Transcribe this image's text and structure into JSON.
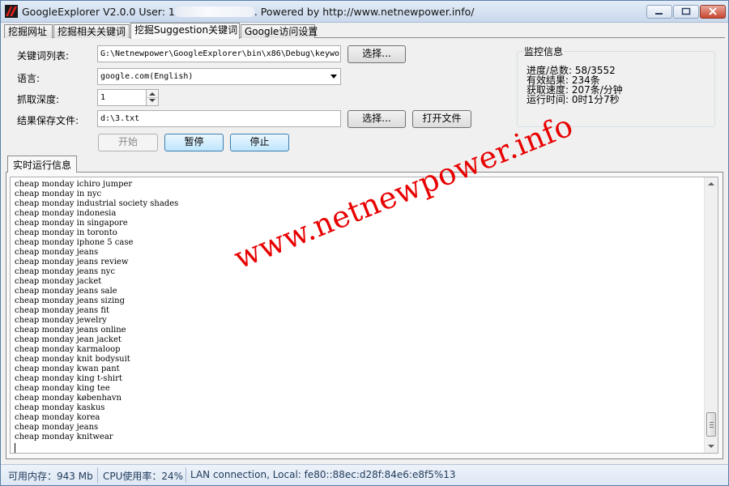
{
  "window": {
    "title_prefix": "GoogleExplorer V2.0.0 User: 1",
    "title_suffix": ". Powered by http://www.netnewpower.info/"
  },
  "tabs": [
    {
      "label": "挖掘网址"
    },
    {
      "label": "挖掘相关关键词"
    },
    {
      "label": "挖掘Suggestion关键词"
    },
    {
      "label": "Google访问设置"
    }
  ],
  "form": {
    "keyword_list_label": "关键词列表:",
    "keyword_list_value": "G:\\Netnewpower\\GoogleExplorer\\bin\\x86\\Debug\\keywo",
    "language_label": "语言:",
    "language_value": "google.com(English)",
    "depth_label": "抓取深度:",
    "depth_value": "1",
    "save_file_label": "结果保存文件:",
    "save_file_value": "d:\\3.txt",
    "choose_label": "选择...",
    "choose_label_2": "选择...",
    "open_file_label": "打开文件",
    "start_label": "开始",
    "pause_label": "暂停",
    "stop_label": "停止"
  },
  "monitor": {
    "title": "监控信息",
    "progress": "进度/总数: 58/3552",
    "valid_results": "有效结果: 234条",
    "speed": "获取速度: 207条/分钟",
    "runtime": "运行时间: 0时1分7秒"
  },
  "log": {
    "tab_label": "实时运行信息",
    "lines": [
      "cheap monday ichiro jumper",
      "cheap monday in nyc",
      "cheap monday industrial society shades",
      "cheap monday indonesia",
      "cheap monday in singapore",
      "cheap monday in toronto",
      "cheap monday iphone 5 case",
      "cheap monday jeans",
      "cheap monday jeans review",
      "cheap monday jeans nyc",
      "cheap monday jacket",
      "cheap monday jeans sale",
      "cheap monday jeans sizing",
      "cheap monday jeans fit",
      "cheap monday jewelry",
      "cheap monday jeans online",
      "cheap monday jean jacket",
      "cheap monday karmaloop",
      "cheap monday knit bodysuit",
      "cheap monday kwan pant",
      "cheap monday king t-shirt",
      "cheap monday king tee",
      "cheap monday københavn",
      "cheap monday kaskus",
      "cheap monday korea",
      "cheap monday jeans",
      "cheap monday knitwear"
    ]
  },
  "watermark": "www.netnewpower.info",
  "statusbar": {
    "memory": "可用内存：943 Mb",
    "cpu": "CPU使用率：24%",
    "network": "LAN connection,  Local: fe80::88ec:d28f:84e6:e8f5%13"
  },
  "colors": {
    "watermark": "#e80000",
    "accent_button": "#bee6fd",
    "status_text": "#1e395b"
  },
  "icons": [
    "app-icon",
    "minimize-icon",
    "maximize-icon",
    "close-icon",
    "dropdown-arrow-icon",
    "spin-up-icon",
    "spin-down-icon",
    "scroll-up-icon",
    "scroll-down-icon"
  ]
}
